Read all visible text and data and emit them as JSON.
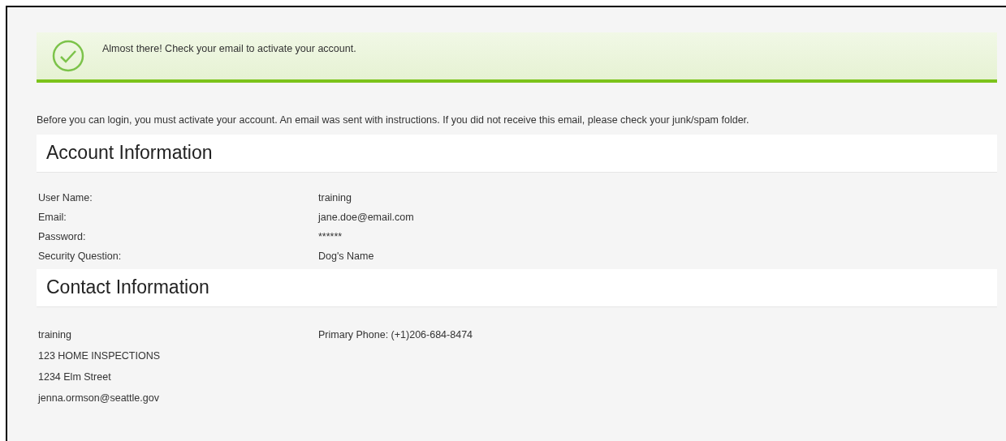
{
  "alert": {
    "message": "Almost there! Check your email to activate your account."
  },
  "intro": "Before you can login, you must activate your account. An email was sent with instructions. If you did not receive this email, please check your junk/spam folder.",
  "account": {
    "title": "Account Information",
    "fields": [
      {
        "label": "User Name:",
        "value": "training"
      },
      {
        "label": "Email:",
        "value": "jane.doe@email.com"
      },
      {
        "label": "Password:",
        "value": "******"
      },
      {
        "label": "Security Question:",
        "value": "Dog's Name"
      }
    ]
  },
  "contact": {
    "title": "Contact Information",
    "lines": [
      "training",
      "123 HOME INSPECTIONS",
      "1234 Elm Street",
      "jenna.ormson@seattle.gov"
    ],
    "phone": "Primary Phone: (+1)206-684-8474"
  }
}
